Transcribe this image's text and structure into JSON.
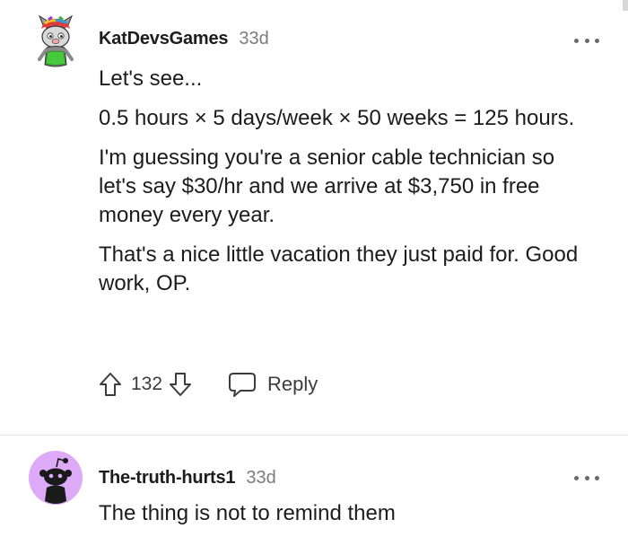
{
  "comments": [
    {
      "author": "KatDevsGames",
      "age": "33d",
      "paragraphs": [
        "Let's see...",
        "0.5 hours × 5 days/week × 50 weeks = 125 hours.",
        "I'm guessing you're a senior cable technician so let's say $30/hr and we arrive at $3,750 in free money every year.",
        "That's a nice little vacation they just paid for. Good work, OP."
      ],
      "score": "132",
      "reply_label": "Reply",
      "avatar_icon": "snoo-avatar-rainbow-hair-icon"
    },
    {
      "author": "The-truth-hurts1",
      "age": "33d",
      "paragraphs": [
        "The thing is not to remind them"
      ],
      "avatar_icon": "default-snoo-avatar-icon",
      "avatar_color": "#dcaaf6"
    }
  ],
  "icons": {
    "upvote": "upvote-arrow-icon",
    "downvote": "downvote-arrow-icon",
    "reply": "speech-bubble-icon",
    "more": "more-options-icon"
  }
}
